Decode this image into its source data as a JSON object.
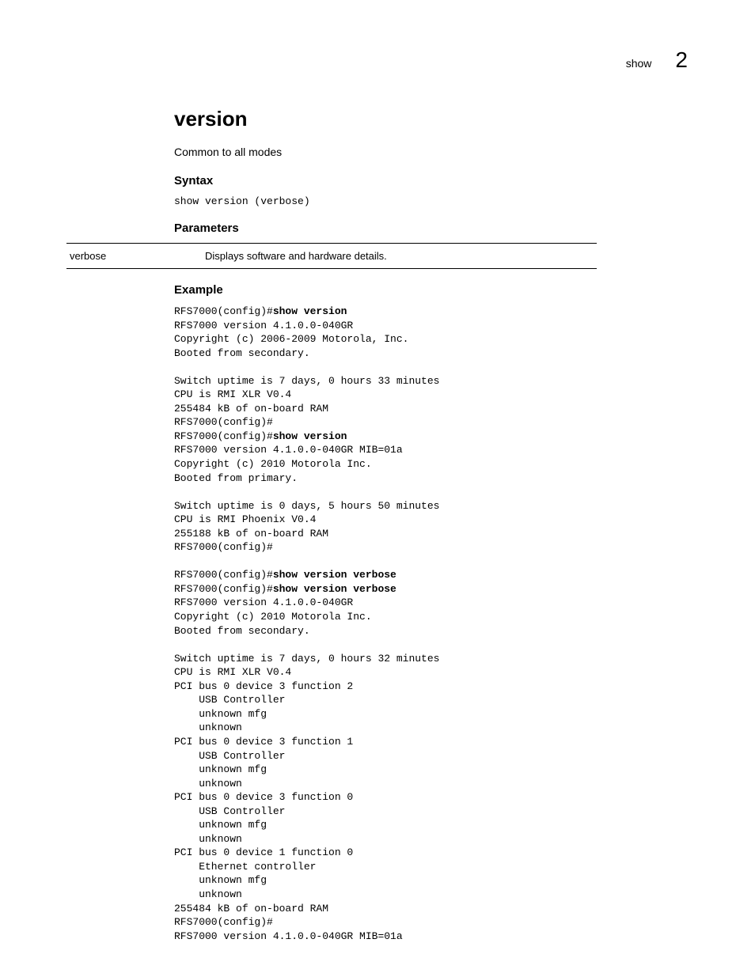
{
  "header": {
    "section": "show",
    "chapter": "2"
  },
  "title": "version",
  "subtitle": "Common to all modes",
  "syntax": {
    "header": "Syntax",
    "code": "show version (verbose)"
  },
  "parameters": {
    "header": "Parameters",
    "rows": [
      {
        "name": "verbose",
        "description": "Displays software and hardware details."
      }
    ]
  },
  "example": {
    "header": "Example",
    "lines": [
      {
        "prefix": "RFS7000(config)#",
        "bold": "show version"
      },
      {
        "text": "RFS7000 version 4.1.0.0-040GR"
      },
      {
        "text": "Copyright (c) 2006-2009 Motorola, Inc."
      },
      {
        "text": "Booted from secondary."
      },
      {
        "text": ""
      },
      {
        "text": "Switch uptime is 7 days, 0 hours 33 minutes"
      },
      {
        "text": "CPU is RMI XLR V0.4"
      },
      {
        "text": "255484 kB of on-board RAM"
      },
      {
        "text": "RFS7000(config)#"
      },
      {
        "prefix": "RFS7000(config)#",
        "bold": "show version"
      },
      {
        "text": "RFS7000 version 4.1.0.0-040GR MIB=01a"
      },
      {
        "text": "Copyright (c) 2010 Motorola Inc."
      },
      {
        "text": "Booted from primary."
      },
      {
        "text": ""
      },
      {
        "text": "Switch uptime is 0 days, 5 hours 50 minutes"
      },
      {
        "text": "CPU is RMI Phoenix V0.4"
      },
      {
        "text": "255188 kB of on-board RAM"
      },
      {
        "text": "RFS7000(config)#"
      },
      {
        "text": ""
      },
      {
        "prefix": "RFS7000(config)#",
        "bold": "show version verbose"
      },
      {
        "prefix": "RFS7000(config)#",
        "bold": "show version verbose"
      },
      {
        "text": "RFS7000 version 4.1.0.0-040GR"
      },
      {
        "text": "Copyright (c) 2010 Motorola Inc."
      },
      {
        "text": "Booted from secondary."
      },
      {
        "text": ""
      },
      {
        "text": "Switch uptime is 7 days, 0 hours 32 minutes"
      },
      {
        "text": "CPU is RMI XLR V0.4"
      },
      {
        "text": "PCI bus 0 device 3 function 2"
      },
      {
        "text": "    USB Controller"
      },
      {
        "text": "    unknown mfg"
      },
      {
        "text": "    unknown"
      },
      {
        "text": "PCI bus 0 device 3 function 1"
      },
      {
        "text": "    USB Controller"
      },
      {
        "text": "    unknown mfg"
      },
      {
        "text": "    unknown"
      },
      {
        "text": "PCI bus 0 device 3 function 0"
      },
      {
        "text": "    USB Controller"
      },
      {
        "text": "    unknown mfg"
      },
      {
        "text": "    unknown"
      },
      {
        "text": "PCI bus 0 device 1 function 0"
      },
      {
        "text": "    Ethernet controller"
      },
      {
        "text": "    unknown mfg"
      },
      {
        "text": "    unknown"
      },
      {
        "text": "255484 kB of on-board RAM"
      },
      {
        "text": "RFS7000(config)#"
      },
      {
        "text": "RFS7000 version 4.1.0.0-040GR MIB=01a"
      }
    ]
  }
}
